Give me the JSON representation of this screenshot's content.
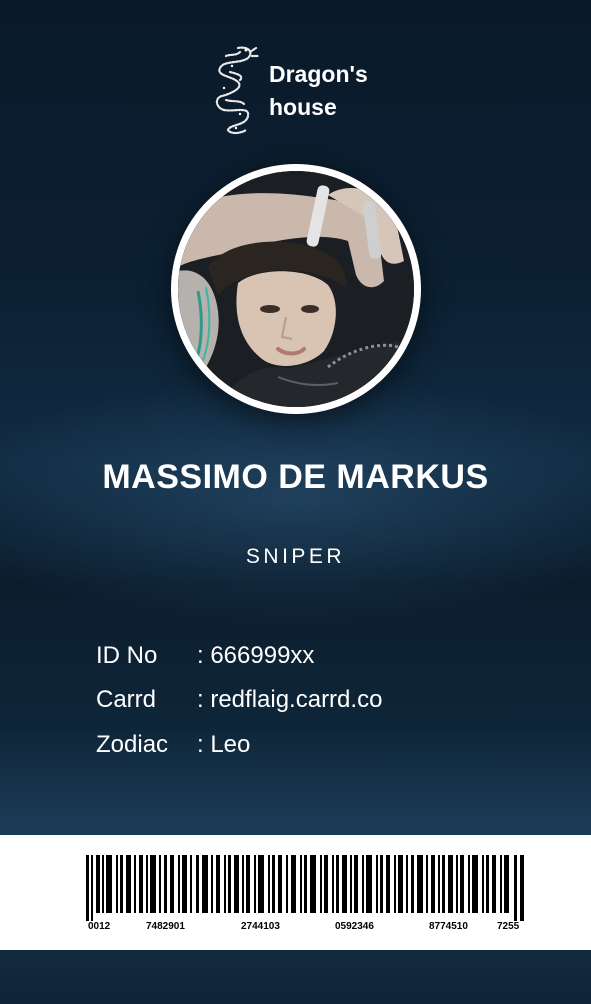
{
  "card": {
    "logo": {
      "text_line1": "Dragon's",
      "text_line2": "house",
      "icon": "dragon-icon"
    },
    "photo": {
      "description": "profile-photo"
    },
    "name": "MASSIMO DE MARKUS",
    "role": "SNIPER",
    "info": [
      {
        "label": "ID No",
        "value": ": 666999xx"
      },
      {
        "label": "Carrd",
        "value": ": redflaig.carrd.co"
      },
      {
        "label": "Zodiac",
        "value": ": Leo"
      }
    ],
    "barcode": {
      "numbers": [
        "0012",
        "7482901",
        "2744103",
        "0592346",
        "8774510",
        "7255"
      ]
    }
  },
  "colors": {
    "background": "#0c2134",
    "text": "#ffffff",
    "strip": "#ffffff",
    "bars": "#000000"
  }
}
